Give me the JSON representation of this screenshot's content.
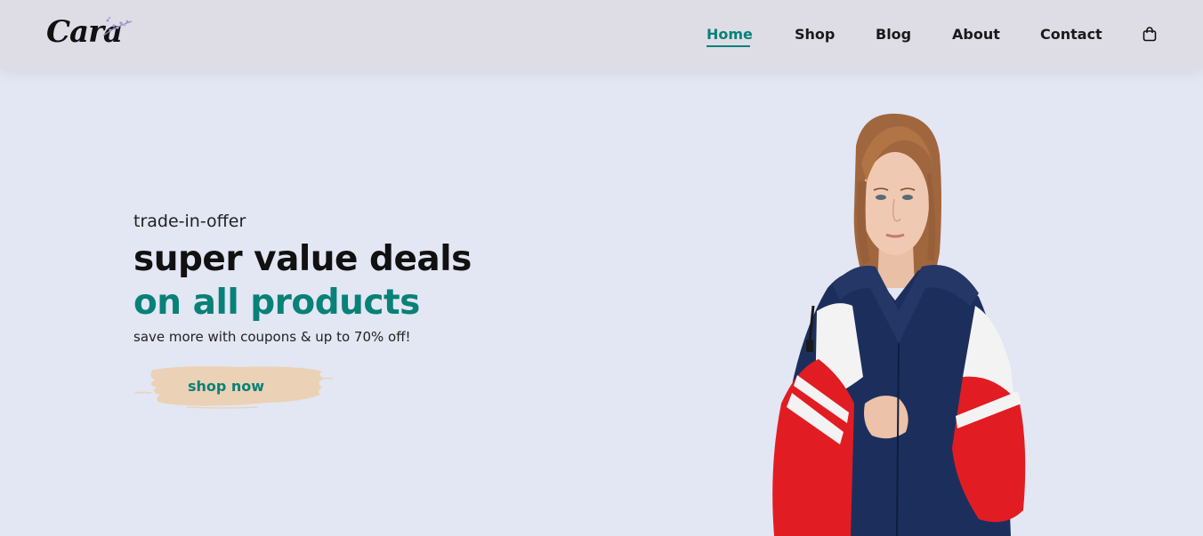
{
  "header": {
    "logo_text": "Cara",
    "nav": [
      {
        "label": "Home",
        "active": true
      },
      {
        "label": "Shop",
        "active": false
      },
      {
        "label": "Blog",
        "active": false
      },
      {
        "label": "About",
        "active": false
      },
      {
        "label": "Contact",
        "active": false
      }
    ],
    "cart_icon": "shopping-bag-icon"
  },
  "hero": {
    "subtitle": "trade-in-offer",
    "title_line1": "super value deals",
    "title_line2": "on all products",
    "description": "save more with coupons & up to 70% off!",
    "button_label": "shop now",
    "image_alt": "model wearing red white and navy track jacket"
  },
  "colors": {
    "accent": "#088178",
    "background": "#e3e6f3",
    "header": "#dedde6",
    "button_brush": "#ebd2b6"
  }
}
